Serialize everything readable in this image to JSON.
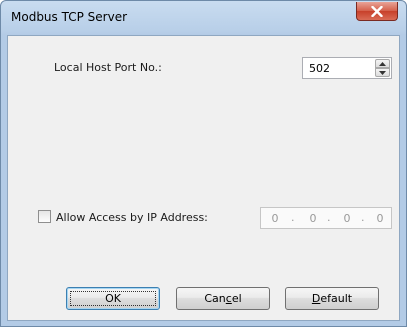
{
  "window": {
    "title": "Modbus TCP Server",
    "close_icon": "close-icon"
  },
  "port": {
    "label": "Local Host Port No.:",
    "value": "502"
  },
  "allow_access": {
    "label": "Allow Access by IP Address:",
    "checked": false,
    "ip": [
      "0",
      "0",
      "0",
      "0"
    ]
  },
  "buttons": {
    "ok": "OK",
    "cancel_pre": "Can",
    "cancel_ul": "c",
    "cancel_post": "el",
    "default_ul": "D",
    "default_post": "efault"
  },
  "colors": {
    "title_bar": "#b8cfe8",
    "close_button": "#c7402a",
    "client_bg": "#f0f0f0"
  }
}
